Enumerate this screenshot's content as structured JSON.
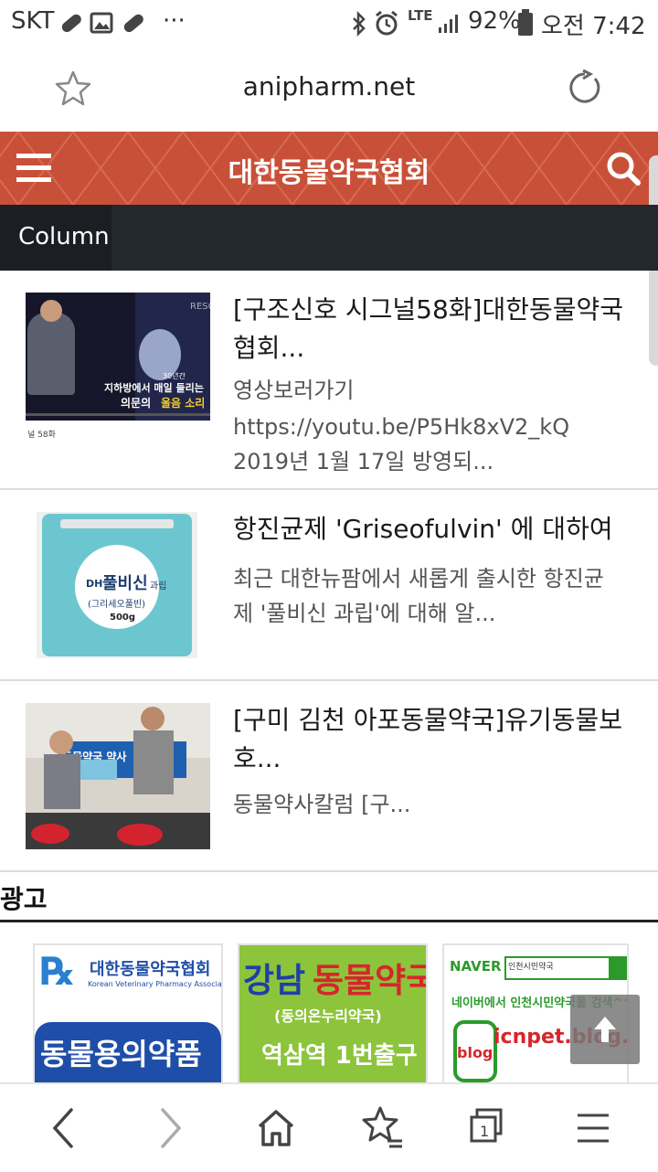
{
  "status": {
    "carrier": "SKT",
    "dots": "···",
    "network": "LTE",
    "battery": "92%",
    "time": "오전 7:42"
  },
  "browser": {
    "url": "anipharm.net"
  },
  "site": {
    "title": "대한동물약국협회",
    "accent": "#c85038",
    "column_tab": "Column"
  },
  "articles": [
    {
      "title": "[구조신호 시그널58화]대한동물약국협회...",
      "excerpt_lines": [
        "영상보러가기",
        "https://youtu.be/P5Hk8xV2_kQ",
        "2019년 1월 17일 방영되..."
      ],
      "thumb": {
        "caption_small": "30년간",
        "caption_line1": "지하방에서 매일 들리는",
        "caption_line2a": "의문의",
        "caption_line2b": "울음 소리",
        "footer": "널 58화"
      }
    },
    {
      "title": "항진균제 'Griseofulvin' 에 대하여",
      "excerpt_lines": [
        "최근 대한뉴팜에서 새롭게 출시한 항진균",
        "제 '풀비신 과립'에 대해 알..."
      ],
      "thumb": {
        "brand": "DH",
        "name": "풀비신",
        "kind": "과립",
        "sub": "(그리세오풀빈)",
        "weight": "500g"
      }
    },
    {
      "title": "[구미 김천 아포동물약국]유기동물보호...",
      "excerpt_lines": [
        "동물약사칼럼 [구..."
      ],
      "thumb": {
        "banner": "동물약국 약사"
      }
    }
  ],
  "ads": {
    "heading": "광고",
    "items": [
      {
        "name": "대한동물약국협회",
        "sub": "Korean Veterinary Pharmacy Association",
        "body": "동물용의약품"
      },
      {
        "name_a": "강남",
        "name_b": "동물약국",
        "sub": "(동의온누리약국)",
        "body": "역삼역 1번출구"
      },
      {
        "brand": "NAVER",
        "search": "인천시민약국",
        "line": "네이버에서 인천시민약국을 검색^^",
        "blog": "blog",
        "url": "icnpet.blog.me"
      }
    ]
  }
}
